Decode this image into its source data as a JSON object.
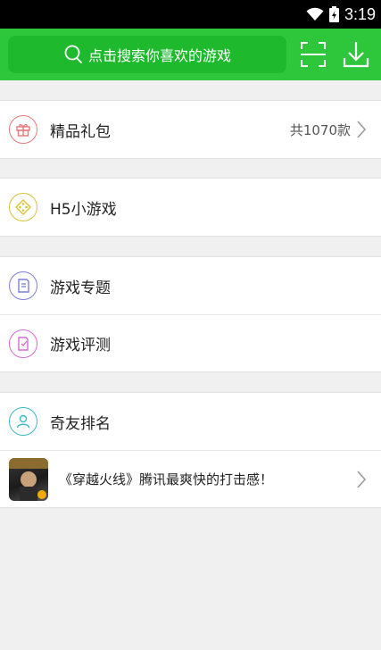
{
  "status_bar": {
    "time": "3:19"
  },
  "search": {
    "placeholder": "点击搜索你喜欢的游戏"
  },
  "menu": {
    "gift": {
      "label": "精品礼包",
      "count": "共1070款"
    },
    "h5": {
      "label": "H5小游戏"
    },
    "topics": {
      "label": "游戏专题"
    },
    "reviews": {
      "label": "游戏评测"
    },
    "ranking": {
      "label": "奇友排名"
    },
    "promo": {
      "text": "《穿越火线》腾讯最爽快的打击感！"
    }
  },
  "colors": {
    "brand_green": "#2ec73c",
    "gift_icon": "#e07b7b",
    "h5_icon": "#d8c23a",
    "topics_icon": "#7a7fd6",
    "reviews_icon": "#d46bd4",
    "ranking_icon": "#3bb8c4"
  }
}
